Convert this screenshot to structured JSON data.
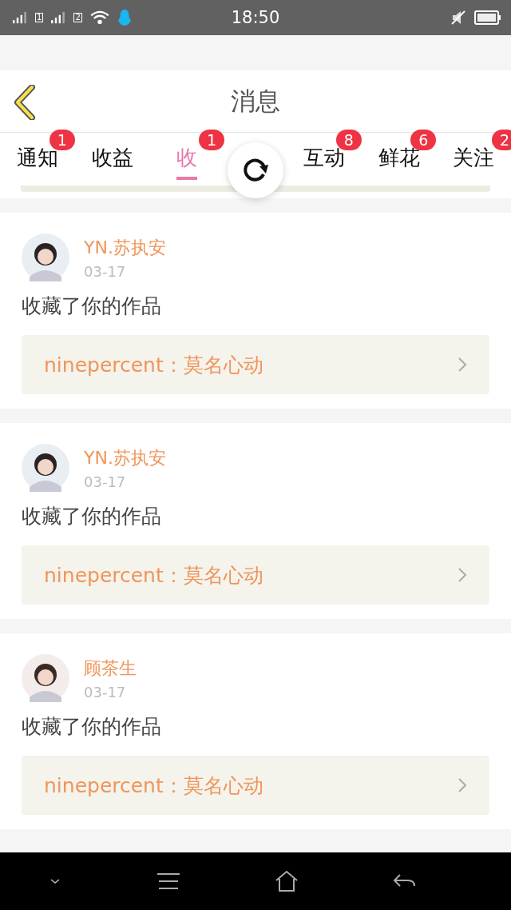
{
  "status_bar": {
    "time": "18:50",
    "sim_labels": [
      "1",
      "2"
    ]
  },
  "header": {
    "title": "消息"
  },
  "tabs": [
    {
      "label": "通知",
      "badge": "1",
      "selected": false
    },
    {
      "label": "收益",
      "selected": false
    },
    {
      "label": "收",
      "badge": "1",
      "selected": true
    },
    {
      "label": "互动",
      "badge": "8",
      "selected": false
    },
    {
      "label": "鲜花",
      "badge": "6",
      "selected": false
    },
    {
      "label": "关注",
      "badge": "2",
      "selected": false
    }
  ],
  "messages": [
    {
      "user": "YN.苏执安",
      "date": "03-17",
      "text": "收藏了你的作品",
      "work": "ninepercent：莫名心动"
    },
    {
      "user": "YN.苏执安",
      "date": "03-17",
      "text": "收藏了你的作品",
      "work": "ninepercent：莫名心动"
    },
    {
      "user": "顾茶生",
      "date": "03-17",
      "text": "收藏了你的作品",
      "work": "ninepercent：莫名心动"
    }
  ]
}
